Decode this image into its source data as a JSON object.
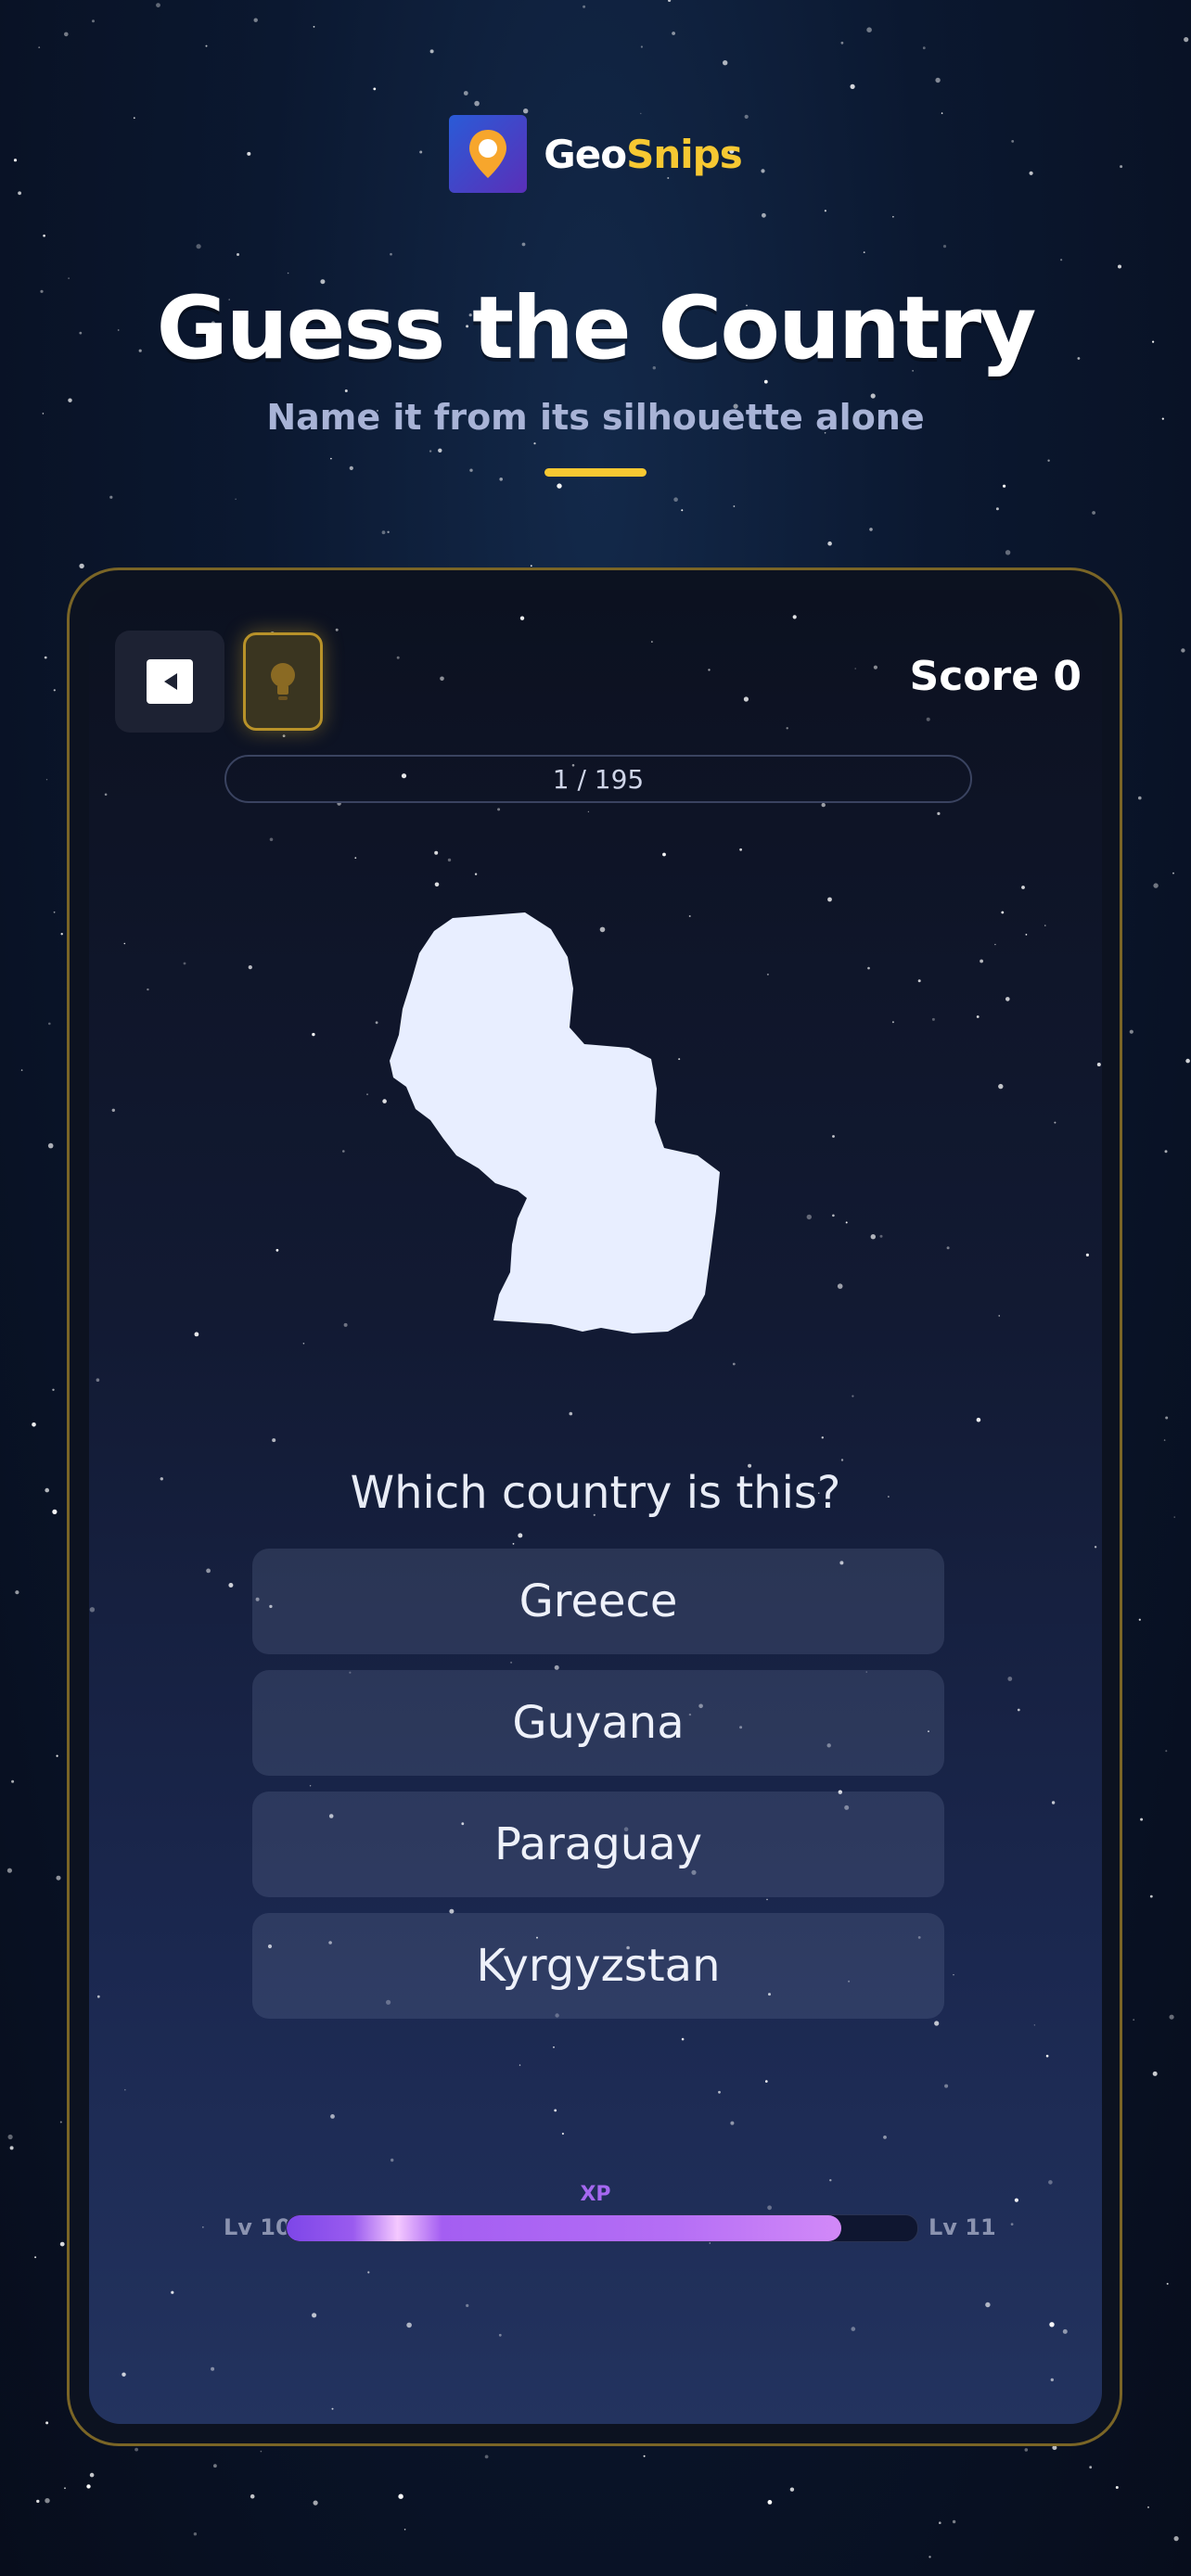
{
  "brand": {
    "name_part1": "Geo",
    "name_part2": "Snips",
    "logo_icon": "map-pin-globe-icon"
  },
  "hero": {
    "title": "Guess the Country",
    "subtitle": "Name it from its silhouette alone"
  },
  "game": {
    "score_label": "Score 0",
    "progress_text": "1 / 195",
    "back_icon": "back-arrow-icon",
    "hint_icon": "lightbulb-icon",
    "question": "Which country is this?",
    "options": [
      "Greece",
      "Guyana",
      "Paraguay",
      "Kyrgyzstan"
    ]
  },
  "xp": {
    "label": "XP",
    "level_current": "Lv 10",
    "level_next": "Lv 11",
    "progress_fraction": 0.88
  },
  "colors": {
    "accent": "#f7c832",
    "xp": "#a568f0",
    "frame": "#7a6526"
  }
}
